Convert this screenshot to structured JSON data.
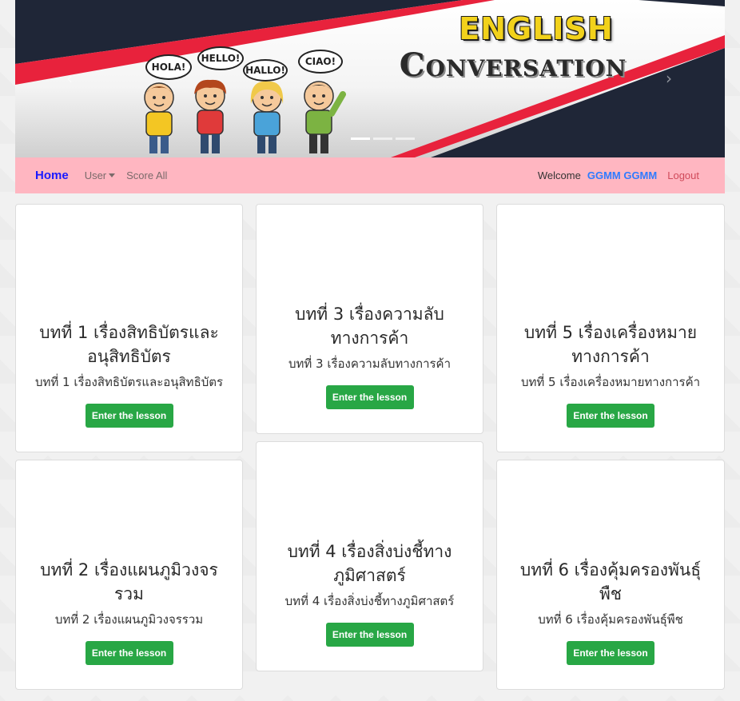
{
  "banner": {
    "title_line1": "ENGLISH",
    "title_line2": "Conversation",
    "greetings": [
      "HOLA!",
      "HELLO!",
      "HALLO!",
      "CIAO!"
    ],
    "slides": 3,
    "active_slide": 1
  },
  "navbar": {
    "brand": "Home",
    "user_menu": "User",
    "score_all": "Score All",
    "welcome": "Welcome",
    "username": "GGMM GGMM",
    "logout": "Logout"
  },
  "lessons": [
    {
      "title": "บทที่ 1 เรื่องสิทธิบัตรและอนุสิทธิบัตร",
      "subtitle": "บทที่ 1 เรื่องสิทธิบัตรและอนุสิทธิบัตร",
      "button": "Enter the lesson"
    },
    {
      "title": "บทที่ 2 เรื่องแผนภูมิวงจรรวม",
      "subtitle": "บทที่ 2 เรื่องแผนภูมิวงจรรวม",
      "button": "Enter the lesson"
    },
    {
      "title": "บทที่ 3 เรื่องความลับทางการค้า",
      "subtitle": "บทที่ 3 เรื่องความลับทางการค้า",
      "button": "Enter the lesson"
    },
    {
      "title": "บทที่ 4 เรื่องสิ่งบ่งชี้ทางภูมิศาสตร์",
      "subtitle": "บทที่ 4 เรื่องสิ่งบ่งชี้ทางภูมิศาสตร์",
      "button": "Enter the lesson"
    },
    {
      "title": "บทที่ 5 เรื่องเครื่องหมายทางการค้า",
      "subtitle": "บทที่ 5 เรื่องเครื่องหมายทางการค้า",
      "button": "Enter the lesson"
    },
    {
      "title": "บทที่ 6 เรื่องคุ้มครองพันธุ์พืช",
      "subtitle": "บทที่ 6 เรื่องคุ้มครองพันธุ์พืช",
      "button": "Enter the lesson"
    }
  ],
  "colors": {
    "navbar_bg": "#ffb6c1",
    "brand": "#1a1aff",
    "username": "#2f7bff",
    "logout": "#d04a5a",
    "button": "#28a745",
    "banner_dark": "#1f2637",
    "banner_red": "#e8223c",
    "title_yellow": "#f2d21b"
  }
}
